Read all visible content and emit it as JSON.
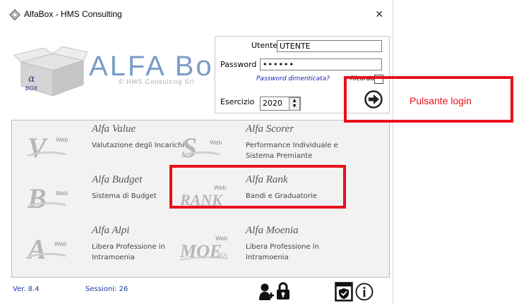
{
  "window": {
    "title": "AlfaBox - HMS Consulting",
    "close_symbol": "×"
  },
  "logo": {
    "text": "ALFA Box",
    "subtitle": "© HMS Consulting Srl",
    "box_letters": "α BOX"
  },
  "login": {
    "user_label": "Utente",
    "user_value": "UTENTE",
    "password_label": "Password",
    "password_value": "••••••",
    "forgot_label": "Password dimenticata?",
    "remember_label": "Ricordami",
    "year_label": "Esercizio",
    "year_value": "2020",
    "login_button_icon": "login-arrow-icon"
  },
  "apps": [
    {
      "name": "Alfa Value",
      "desc": "Valutazione degli Incarichi",
      "letter": "V",
      "tag": "Web"
    },
    {
      "name": "Alfa Scorer",
      "desc": "Performance Individuale e Sistema Premiante",
      "letter": "S",
      "tag": "Web"
    },
    {
      "name": "Alfa Budget",
      "desc": "Sistema di Budget",
      "letter": "B",
      "tag": "Web"
    },
    {
      "name": "Alfa Rank",
      "desc": "Bandi e Graduatorie",
      "letter": "RANK",
      "tag": "Web"
    },
    {
      "name": "Alfa Alpi",
      "desc": "Libera Professione in Intramoenia",
      "letter": "A",
      "tag": "Web"
    },
    {
      "name": "Alfa Moenia",
      "desc": "Libera Professione in Intramoenia",
      "letter": "MOE",
      "tag": "Web",
      "sub": "NIA"
    }
  ],
  "footer": {
    "version": "Ver. 8.4",
    "sessions": "Sessioni: 26"
  },
  "annotation": {
    "login_label": "Pulsante login",
    "color": "#e8101a"
  }
}
